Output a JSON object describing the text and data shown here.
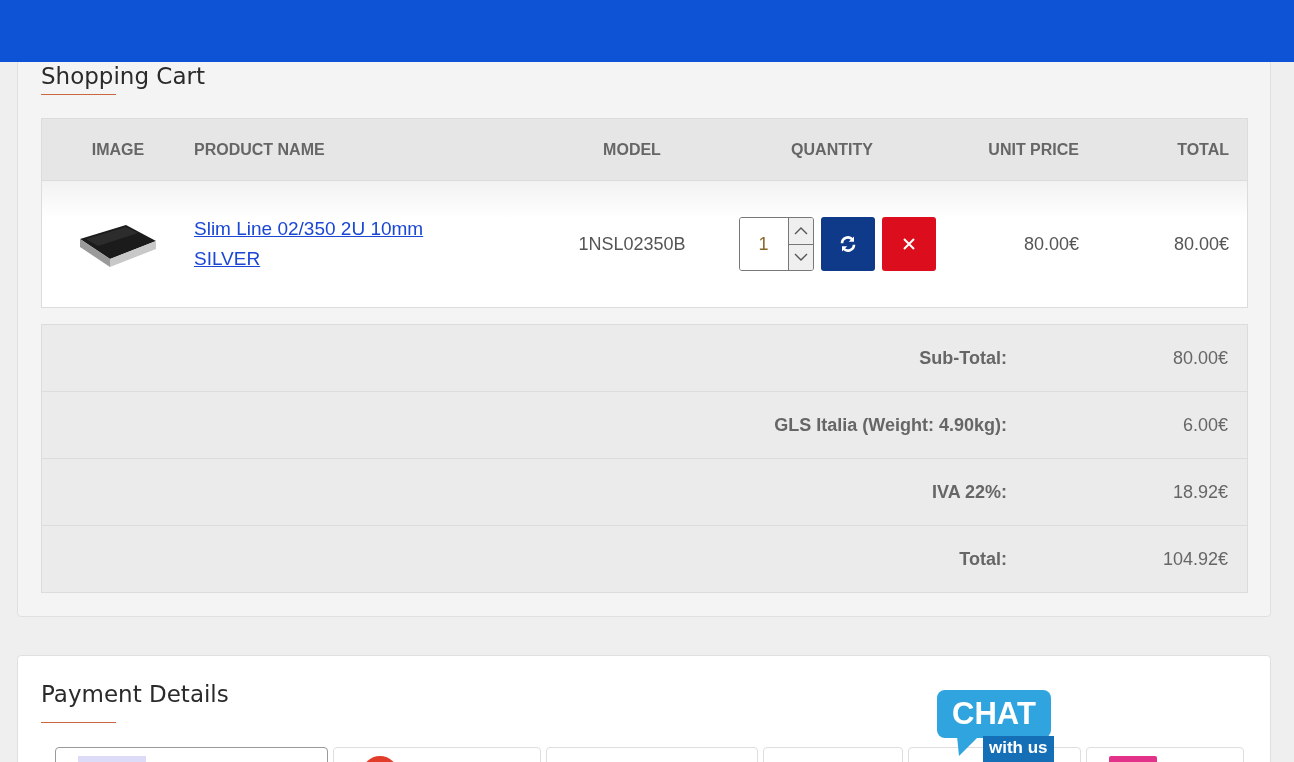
{
  "cart": {
    "title": "Shopping Cart",
    "columns": [
      "IMAGE",
      "PRODUCT NAME",
      "MODEL",
      "QUANTITY",
      "UNIT PRICE",
      "TOTAL"
    ],
    "items": [
      {
        "name": "Slim Line 02/350 2U 10mm SILVER",
        "model": "1NSL02350B",
        "quantity": "1",
        "unit_price": "80.00€",
        "total": "80.00€"
      }
    ],
    "totals": [
      {
        "label": "Sub-Total:",
        "value": "80.00€"
      },
      {
        "label": "GLS Italia (Weight: 4.90kg):",
        "value": "6.00€"
      },
      {
        "label": "IVA 22%:",
        "value": "18.92€"
      },
      {
        "label": "Total:",
        "value": "104.92€"
      }
    ]
  },
  "payment": {
    "title": "Payment Details",
    "methods": [
      {
        "selected": true
      },
      {
        "selected": false
      },
      {
        "selected": false
      },
      {
        "selected": false
      },
      {
        "selected": false
      },
      {
        "selected": false
      }
    ]
  },
  "chat_badge": {
    "line1": "CHAT",
    "line2": "with us"
  }
}
